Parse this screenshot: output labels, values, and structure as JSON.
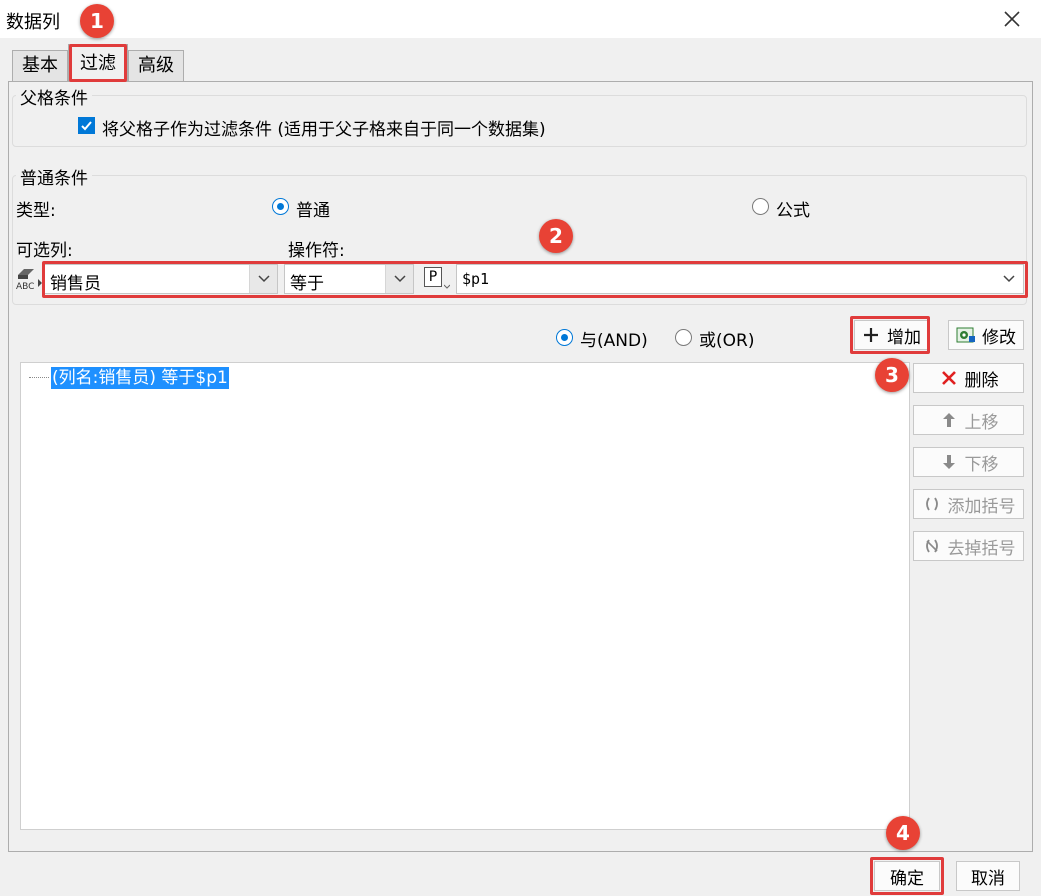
{
  "window": {
    "title": "数据列"
  },
  "tabs": [
    {
      "label": "基本",
      "active": false
    },
    {
      "label": "过滤",
      "active": true
    },
    {
      "label": "高级",
      "active": false
    }
  ],
  "parent_condition": {
    "legend": "父格条件",
    "checkbox_label": "将父格子作为过滤条件 (适用于父子格来自于同一个数据集)",
    "checked": true
  },
  "normal_condition": {
    "legend": "普通条件",
    "type_label": "类型:",
    "type_options": [
      {
        "label": "普通",
        "selected": true
      },
      {
        "label": "公式",
        "selected": false
      }
    ],
    "column_label": "可选列:",
    "operator_label": "操作符:",
    "column_value": "销售员",
    "operator_value": "等于",
    "param_icon": "P",
    "value": "$p1"
  },
  "logic": {
    "and_label": "与(AND)",
    "or_label": "或(OR)",
    "selected": "and"
  },
  "buttons": {
    "add": "增加",
    "modify": "修改",
    "delete": "删除",
    "move_up": "上移",
    "move_down": "下移",
    "add_bracket": "添加括号",
    "remove_bracket": "去掉括号",
    "ok": "确定",
    "cancel": "取消"
  },
  "conditions": [
    {
      "text": "(列名:销售员) 等于$p1"
    }
  ],
  "markers": [
    "1",
    "2",
    "3",
    "4"
  ],
  "colors": {
    "accent": "#0078d7",
    "highlight": "#e03b3b",
    "marker": "#e84235",
    "selection": "#1e90ff"
  }
}
